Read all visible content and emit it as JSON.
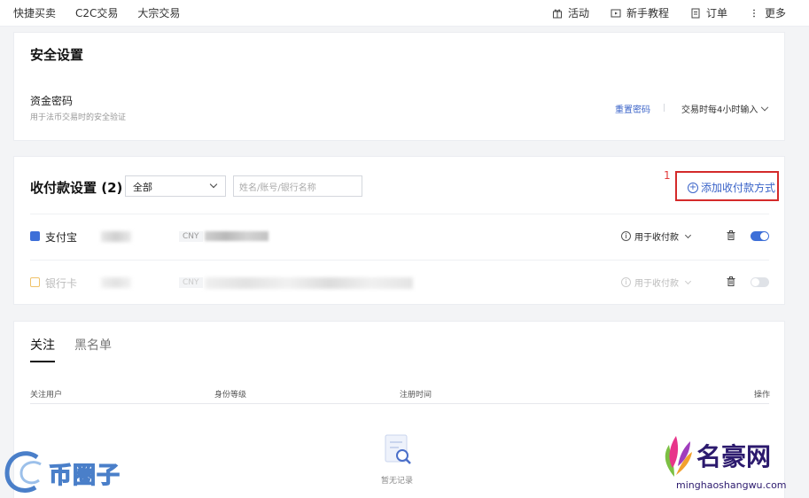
{
  "topnav": {
    "left": [
      "快捷买卖",
      "C2C交易",
      "大宗交易"
    ],
    "right": [
      {
        "label": "活动",
        "icon": "gift-icon"
      },
      {
        "label": "新手教程",
        "icon": "play-icon"
      },
      {
        "label": "订单",
        "icon": "document-icon"
      },
      {
        "label": "更多",
        "icon": "more-icon"
      }
    ]
  },
  "security": {
    "title": "安全设置",
    "fund_password_label": "资金密码",
    "fund_password_desc": "用于法币交易时的安全验证",
    "reset_link": "重置密码",
    "frequency": "交易时每4小时输入"
  },
  "payments": {
    "title": "收付款设置 (2)",
    "filter_selected": "全部",
    "search_placeholder": "姓名/账号/银行名称",
    "annotation_number": "1",
    "add_button": "添加收付款方式",
    "rows": [
      {
        "name": "支付宝",
        "currency": "CNY",
        "usage": "用于收付款",
        "enabled": true,
        "icon_color": "#3d6fd8"
      },
      {
        "name": "银行卡",
        "currency": "CNY",
        "usage": "用于收付款",
        "enabled": false,
        "icon_color": "#f0c26a"
      }
    ]
  },
  "follow": {
    "tabs": [
      "关注",
      "黑名单"
    ],
    "columns": [
      "关注用户",
      "身份等级",
      "注册时间",
      "操作"
    ],
    "empty_text": "暂无记录"
  },
  "watermarks": {
    "left_text": "币圈子",
    "right_brand": "名豪网",
    "right_url": "minghaoshangwu.com"
  },
  "colors": {
    "accent": "#3a63c8",
    "highlight_border": "#d42a2a",
    "toggle_on": "#3d6fd8"
  }
}
